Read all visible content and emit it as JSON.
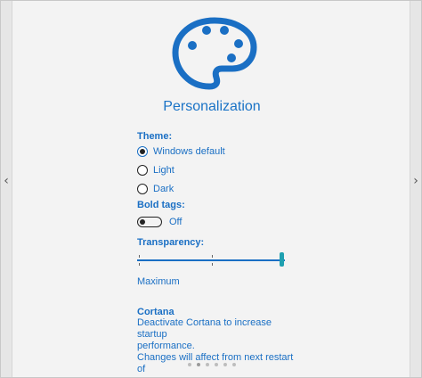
{
  "title": "Personalization",
  "theme": {
    "label": "Theme:",
    "options": [
      {
        "label": "Windows default",
        "checked": true
      },
      {
        "label": "Light",
        "checked": false
      },
      {
        "label": "Dark",
        "checked": false
      }
    ]
  },
  "bold_tags": {
    "label": "Bold tags:",
    "state_label": "Off",
    "on": false
  },
  "transparency": {
    "label": "Transparency:",
    "value_label": "Maximum",
    "level": 1.0
  },
  "cortana": {
    "title": "Cortana",
    "line1": "Deactivate Cortana to increase startup",
    "line2": "performance.",
    "line3": "Changes will affect from next restart of"
  },
  "pager": {
    "count": 6,
    "active_index": 1
  },
  "nav": {
    "prev_icon": "chevron-left-icon",
    "next_icon": "chevron-right-icon"
  },
  "colors": {
    "accent": "#1a6fc4",
    "thumb": "#1fa0b0"
  }
}
